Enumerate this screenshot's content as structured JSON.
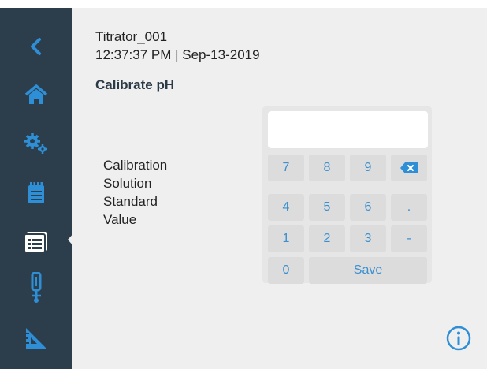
{
  "device": {
    "name": "Titrator_001",
    "datetime": "12:37:37 PM | Sep-13-2019"
  },
  "page_title": "Calibrate pH",
  "field_label": {
    "line1": "Calibration",
    "line2": "Solution",
    "line3": "Standard",
    "line4": "Value"
  },
  "input": {
    "value": "",
    "placeholder": ""
  },
  "keypad": {
    "row1": [
      "7",
      "8",
      "9"
    ],
    "row2": [
      "4",
      "5",
      "6",
      "."
    ],
    "row3": [
      "1",
      "2",
      "3",
      "-"
    ],
    "zero": "0",
    "save": "Save",
    "backspace_icon": "backspace-icon"
  },
  "sidebar": {
    "items": [
      {
        "icon": "back-chevron-icon"
      },
      {
        "icon": "home-icon"
      },
      {
        "icon": "settings-gears-icon"
      },
      {
        "icon": "notepad-icon"
      },
      {
        "icon": "list-card-icon",
        "selected": true
      },
      {
        "icon": "probe-icon"
      },
      {
        "icon": "ruler-triangle-icon"
      }
    ]
  },
  "colors": {
    "sidebar_bg": "#2c3e4c",
    "accent": "#2e8fd6",
    "key_text": "#3a8fd0",
    "content_bg": "#efefef"
  },
  "info_icon": "info-icon"
}
